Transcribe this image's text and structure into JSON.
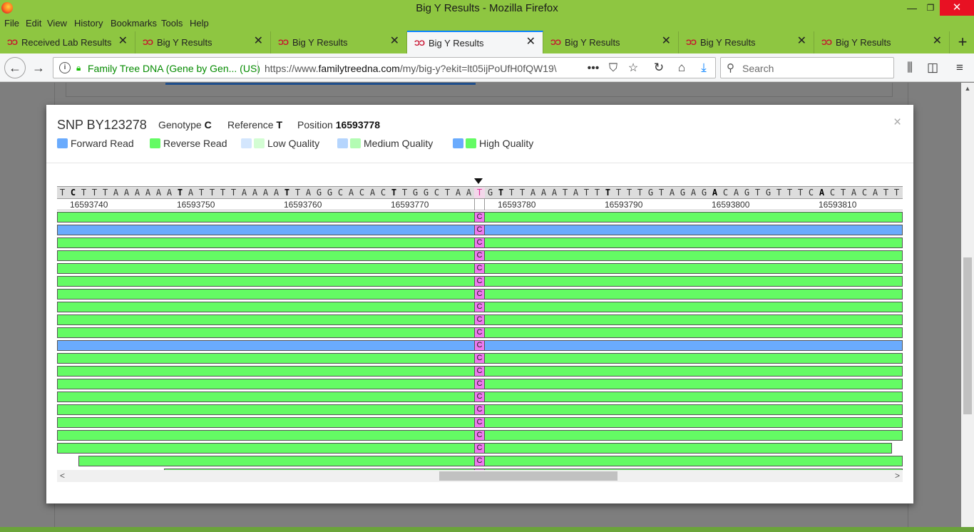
{
  "window": {
    "title": "Big Y Results - Mozilla Firefox"
  },
  "menu": [
    "File",
    "Edit",
    "View",
    "History",
    "Bookmarks",
    "Tools",
    "Help"
  ],
  "tabs": [
    {
      "label": "Received Lab Results",
      "active": false
    },
    {
      "label": "Big Y Results",
      "active": false
    },
    {
      "label": "Big Y Results",
      "active": false
    },
    {
      "label": "Big Y Results",
      "active": true
    },
    {
      "label": "Big Y Results",
      "active": false
    },
    {
      "label": "Big Y Results",
      "active": false
    },
    {
      "label": "Big Y Results",
      "active": false
    }
  ],
  "navbar": {
    "identity": "Family Tree DNA (Gene by Gen... (US)",
    "url_prefix": "https://www.",
    "url_domain": "familytreedna.com",
    "url_rest": "/my/big-y?ekit=lt05ijPoUfH0fQW19\\",
    "search_placeholder": "Search"
  },
  "modal": {
    "snp": "SNP BY123278",
    "genotype_label": "Genotype",
    "genotype": "C",
    "reference_label": "Reference",
    "reference": "T",
    "position_label": "Position",
    "position": "16593778",
    "legend": [
      {
        "label": "Forward Read",
        "colors": [
          "#6aabfd"
        ]
      },
      {
        "label": "Reverse Read",
        "colors": [
          "#64fb64"
        ]
      },
      {
        "label": "Low Quality",
        "colors": [
          "#d3e6fd",
          "#d3fdd3"
        ]
      },
      {
        "label": "Medium Quality",
        "colors": [
          "#b5d5fd",
          "#b3fcb3"
        ]
      },
      {
        "label": "High Quality",
        "colors": [
          "#6aabfd",
          "#64fb64"
        ]
      }
    ]
  },
  "viewer": {
    "reference_sequence": "TCTTTAAAAAATATTTTAAAATTAGGCACACTTGGCTAATGTTTAAATATTTTTTGTAGAGACAGTGTTTCACTACATT",
    "bold_indices": [
      1,
      11,
      21,
      31,
      41,
      51,
      61,
      71
    ],
    "snp_index": 39,
    "position_labels": [
      "16593740",
      "16593750",
      "16593760",
      "16593770",
      "16593780",
      "16593790",
      "16593800",
      "16593810"
    ],
    "call": "C",
    "reads": [
      "rev",
      "fwd",
      "rev",
      "rev",
      "rev",
      "rev",
      "rev",
      "rev",
      "rev",
      "rev",
      "fwd",
      "rev",
      "rev",
      "rev",
      "rev",
      "rev",
      "rev",
      "rev",
      "rev",
      "rev",
      "rev"
    ]
  }
}
